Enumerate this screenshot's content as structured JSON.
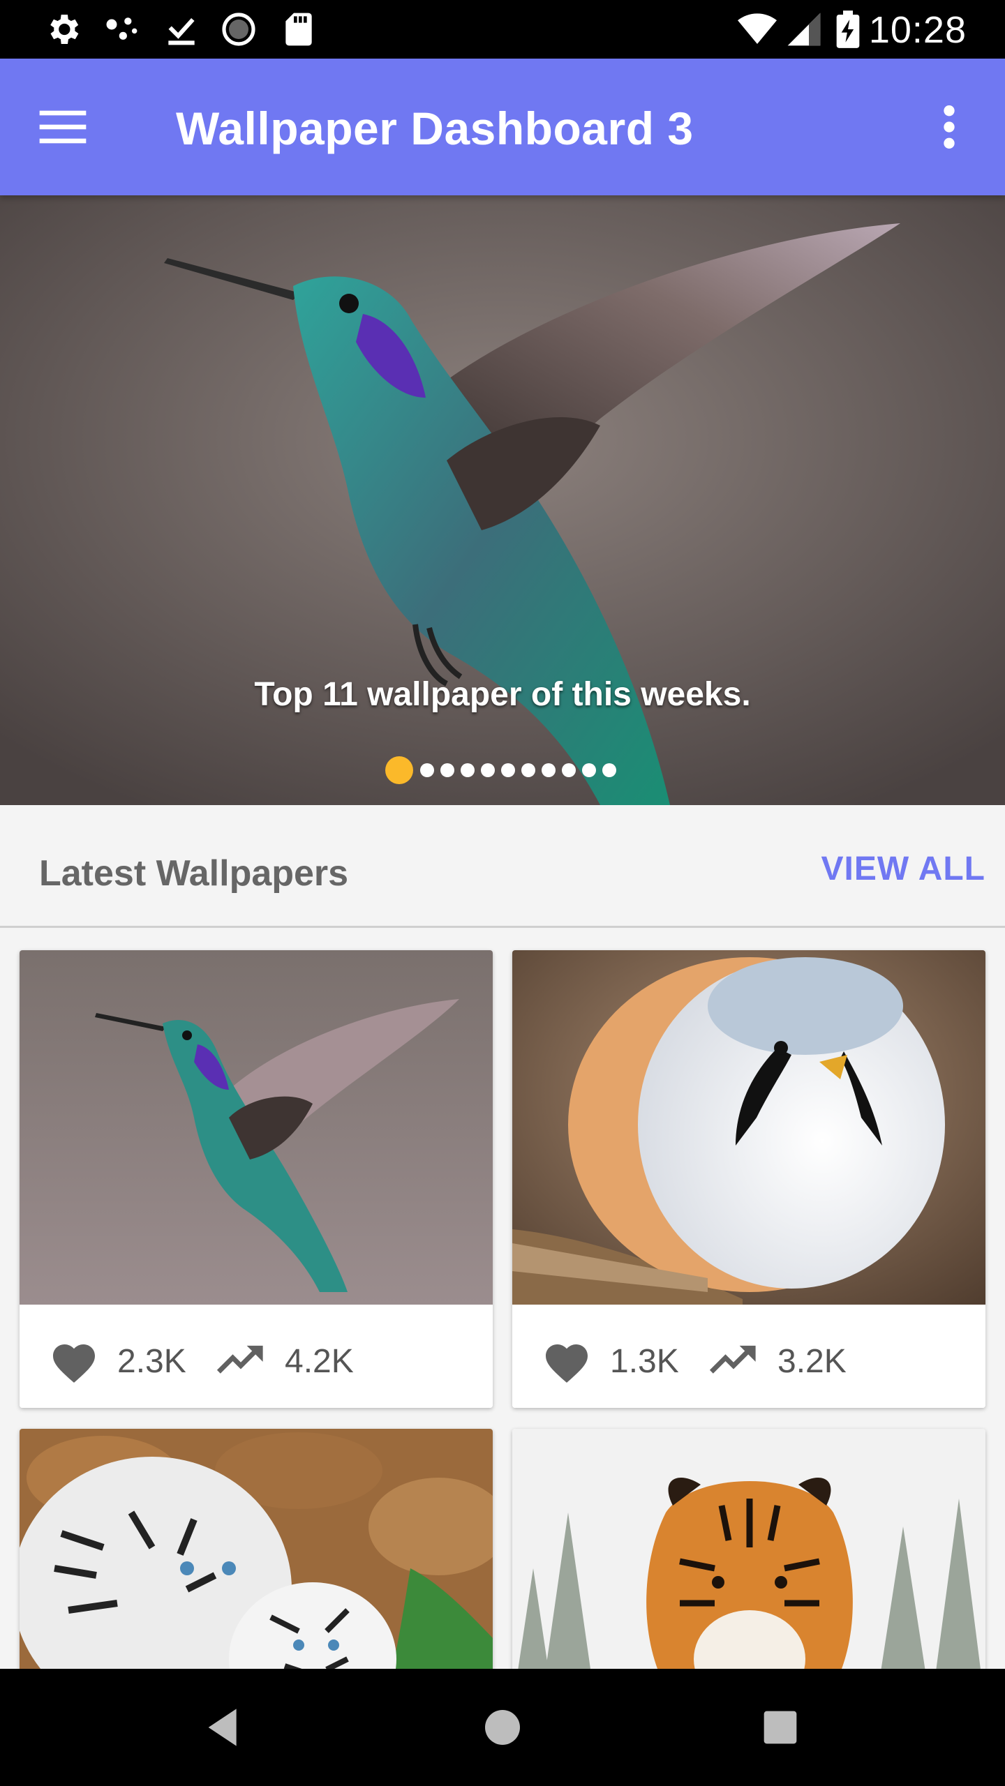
{
  "status_bar": {
    "time": "10:28",
    "left_icons": [
      "settings-icon",
      "connection-dots-icon",
      "download-done-icon",
      "loading-circle-icon",
      "sd-card-icon"
    ],
    "right_icons": [
      "wifi-icon",
      "signal-icon",
      "battery-charging-icon"
    ]
  },
  "app_bar": {
    "title": "Wallpaper Dashboard 3",
    "background": "#7078f2",
    "menu_icon": "menu-icon",
    "overflow_icon": "more-vert-icon"
  },
  "carousel": {
    "caption": "Top 11 wallpaper of this weeks.",
    "slide_count": 11,
    "active_index": 0,
    "active_dot_color": "#fbb92a"
  },
  "section": {
    "title": "Latest Wallpapers",
    "view_all": "VIEW ALL",
    "accent": "#7078f2"
  },
  "wallpapers": [
    {
      "subject": "hummingbird",
      "likes": "2.3K",
      "views": "4.2K"
    },
    {
      "subject": "bearded tit bird",
      "likes": "1.3K",
      "views": "3.2K"
    },
    {
      "subject": "white tigers"
    },
    {
      "subject": "tiger in snow"
    }
  ],
  "nav_bar": {
    "buttons": [
      "back-icon",
      "home-icon",
      "recents-icon"
    ]
  }
}
